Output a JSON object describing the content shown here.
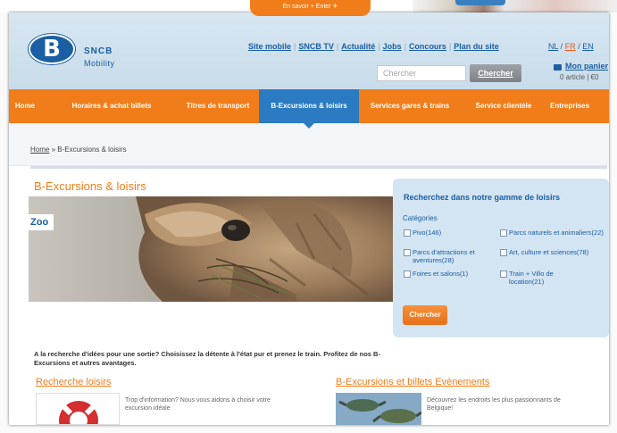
{
  "top_banner": {
    "button_label": "En savoir + Enter ✈"
  },
  "brand": {
    "logo_letter": "B",
    "name": "SNCB",
    "sub": "Mobility"
  },
  "utility_links": [
    "Site mobile",
    "SNCB TV",
    "Actualité",
    "Jobs",
    "Concours",
    "Plan du site"
  ],
  "languages": [
    "NL",
    "FR",
    "EN"
  ],
  "active_language": "FR",
  "search": {
    "placeholder": "Chercher",
    "button_label": "Chercher"
  },
  "cart": {
    "title": "Mon panier",
    "count": "0 article | €0"
  },
  "nav": {
    "items": [
      {
        "label": "Home"
      },
      {
        "label": "Horaires & achat billets"
      },
      {
        "label": "Titres de transport"
      },
      {
        "label": "B-Excursions & loisirs"
      },
      {
        "label": "Services gares & trains"
      },
      {
        "label": "Service clientèle"
      },
      {
        "label": "Entreprises"
      }
    ],
    "active_index": 3
  },
  "breadcrumb": {
    "home": "Home",
    "separator": "»",
    "current": "B-Excursions & loisirs"
  },
  "page_title": "B-Excursions & loisirs",
  "hero": {
    "tag": "Zoo"
  },
  "search_panel": {
    "title": "Recherchez dans notre gamme de loisirs",
    "categories_label": "Catégories",
    "categories": [
      {
        "label": "Pivo(146)"
      },
      {
        "label": "Parcs naturels et animaliers(22)"
      },
      {
        "label": "Parcs d'attractions et aventures(28)"
      },
      {
        "label": "Art, culture et sciences(78)"
      },
      {
        "label": "Foires et salons(1)"
      },
      {
        "label": "Train + Villo de location(21)"
      }
    ],
    "button_label": "Chercher"
  },
  "intro_text": "A la recherche d'idées pour une sortie? Choisissez la détente à l'état pur et prenez le train. Profitez de nos B-Excursions et autres avantages.",
  "sections": [
    {
      "title": "Recherche loisirs",
      "text": "Trop d'information? Nous vous aidons à choisir votre excursion idéale"
    },
    {
      "title": "B-Excursions et billets Evènements",
      "text": "Découvrez les endroits les plus passionnants de Belgique!"
    }
  ],
  "colors": {
    "brand_blue": "#1a5ea3",
    "orange": "#f07d1a",
    "nav_active": "#2b7bc3",
    "panel": "#d3e5f3"
  }
}
